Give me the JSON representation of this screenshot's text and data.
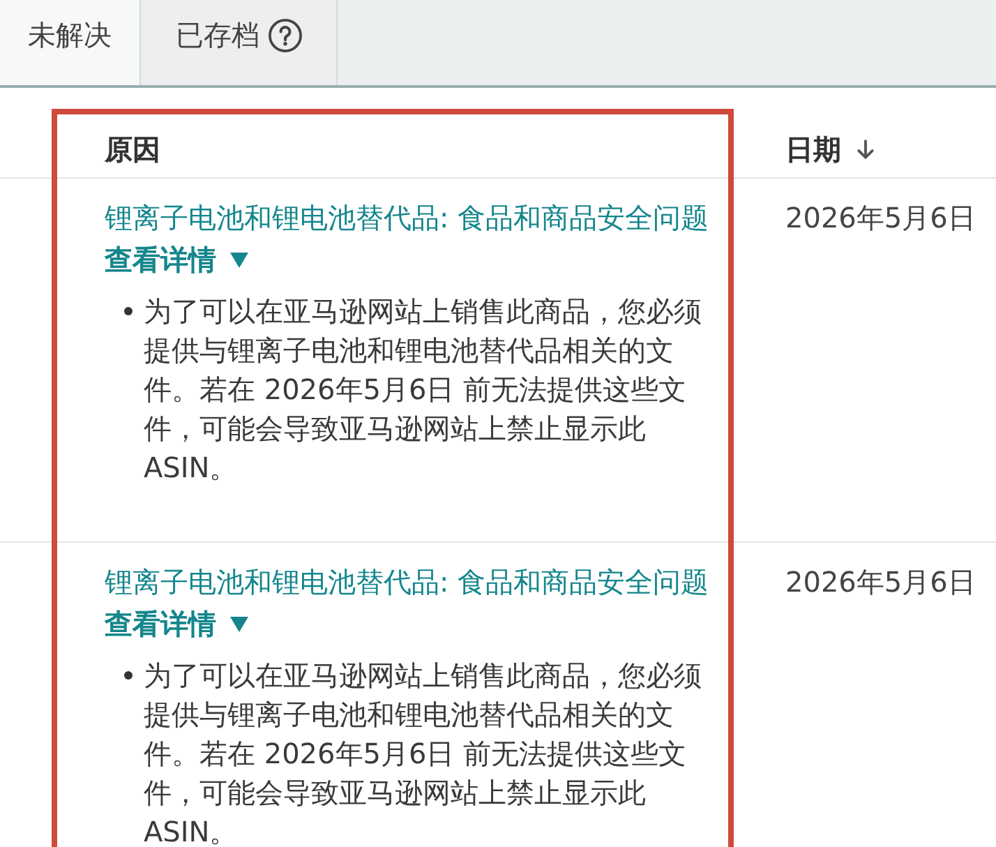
{
  "tabs": [
    {
      "label": "未解决",
      "selected": true,
      "help": false
    },
    {
      "label": "已存档",
      "selected": false,
      "help": true
    }
  ],
  "table": {
    "columns": [
      {
        "label": "原因",
        "sorted_descending": false,
        "highlighted": true
      },
      {
        "label": "日期",
        "sorted_descending": true,
        "highlighted": false
      }
    ],
    "rows": [
      {
        "reason": "锂离子电池和锂电池替代品: 食品和商品安全问题",
        "toggle": "查看详情",
        "expanded": true,
        "details": [
          "为了可以在亚马逊网站上销售此商品，您必须提供与锂离子电池和锂电池替代品相关的文件。若在 2026年5月6日 前无法提供这些文件，可能会导致亚马逊网站上禁止显示此ASIN。"
        ],
        "date": "2026年5月6日"
      },
      {
        "reason": "锂离子电池和锂电池替代品: 食品和商品安全问题",
        "toggle": "查看详情",
        "expanded": true,
        "details": [
          "为了可以在亚马逊网站上销售此商品，您必须提供与锂离子电池和锂电池替代品相关的文件。若在 2026年5月6日 前无法提供这些文件，可能会导致亚马逊网站上禁止显示此ASIN。"
        ],
        "date": "2026年5月6日"
      }
    ]
  }
}
